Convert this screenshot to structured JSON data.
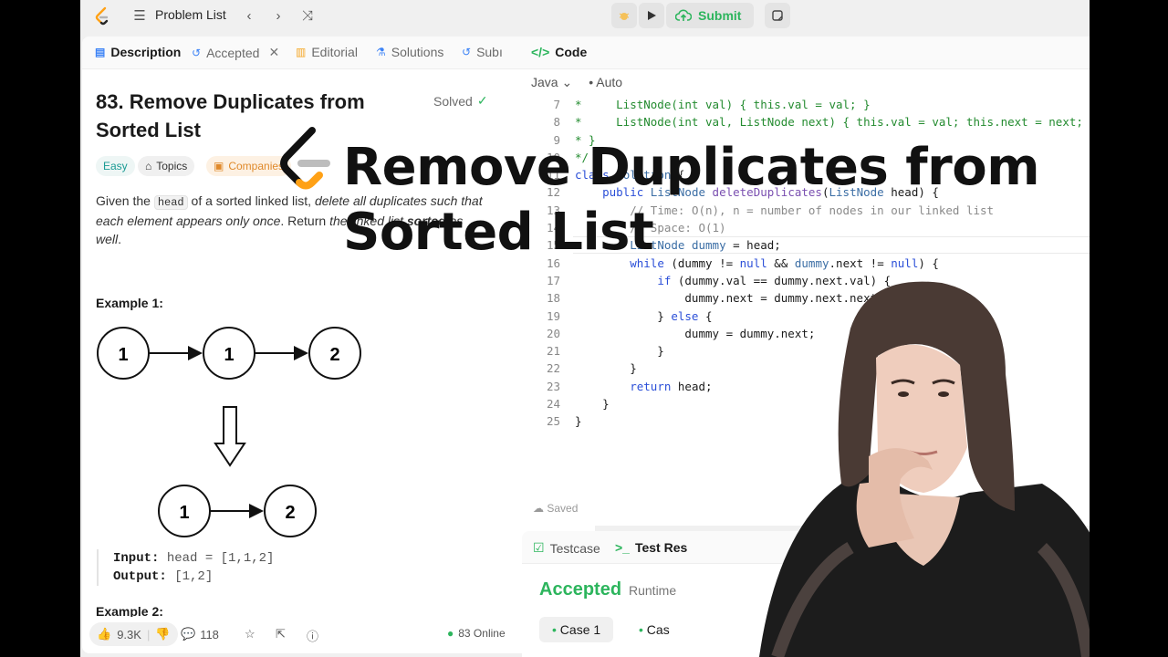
{
  "topbar": {
    "problem_list": "Problem List",
    "submit": "Submit"
  },
  "left_tabs": {
    "description": "Description",
    "accepted": "Accepted",
    "editorial": "Editorial",
    "solutions": "Solutions",
    "submissions": "Subı"
  },
  "problem": {
    "title": "83. Remove Duplicates from Sorted List",
    "status": "Solved",
    "difficulty": "Easy",
    "topics": "Topics",
    "companies": "Companies",
    "desc_a": "Given the ",
    "desc_head": "head",
    "desc_b": " of a sorted linked list, ",
    "desc_c": "delete all duplicates such that each element appears only once",
    "desc_d": ". Return ",
    "desc_e": "the linked list ",
    "desc_f": "sorted",
    "desc_g": " as well",
    "desc_h": "."
  },
  "example1": {
    "title": "Example 1:",
    "input_label": "Input:",
    "input_value": "head = [1,1,2]",
    "output_label": "Output:",
    "output_value": "[1,2]",
    "before_nodes": [
      "1",
      "1",
      "2"
    ],
    "after_nodes": [
      "1",
      "2"
    ]
  },
  "example2": {
    "title": "Example 2:"
  },
  "footer": {
    "likes": "9.3K",
    "comments": "118",
    "online": "83 Online"
  },
  "editor": {
    "tab": "Code",
    "language": "Java",
    "mode": "Auto",
    "saved": "Saved",
    "line_numbers": [
      "7",
      "8",
      "9",
      "10",
      "11",
      "12",
      "13",
      "14",
      "15",
      "16",
      "17",
      "18",
      "19",
      "20",
      "21",
      "22",
      "23",
      "24",
      "25"
    ]
  },
  "result": {
    "testcase_tab": "Testcase",
    "result_tab": "Test Res",
    "status": "Accepted",
    "runtime": "Runtime",
    "case1": "Case 1",
    "case2": "Cas"
  },
  "overlay": {
    "title": "Remove Duplicates from Sorted List"
  },
  "colors": {
    "accent_green": "#2db55d",
    "easy_teal": "#1a9b94",
    "logo_orange": "#ffa116"
  }
}
